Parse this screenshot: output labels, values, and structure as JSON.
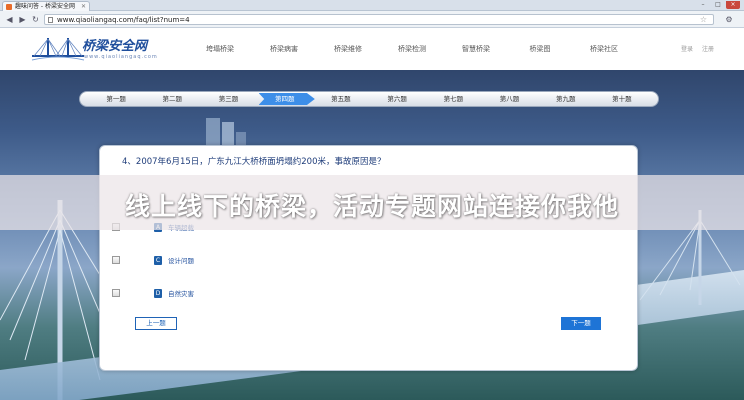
{
  "browser": {
    "tab_title": "趣味问答 - 桥梁安全网",
    "url": "www.qiaoliangaq.com/faq/list?num=4",
    "window_controls": [
      "–",
      "□",
      "×"
    ]
  },
  "site": {
    "logo_text": "桥梁安全网",
    "logo_url": "www.qiaoliangaq.com",
    "nav": [
      "垮塌桥梁",
      "桥梁病害",
      "桥梁维修",
      "桥梁检测",
      "智慧桥梁",
      "桥梁图",
      "桥梁社区"
    ],
    "toplinks": [
      "登录",
      "注册"
    ]
  },
  "steps": {
    "items": [
      "第一题",
      "第二题",
      "第三题",
      "第四题",
      "第五题",
      "第六题",
      "第七题",
      "第八题",
      "第九题",
      "第十题"
    ],
    "active_index": 3
  },
  "quiz": {
    "question": "4、2007年6月15日，广东九江大桥桥面坍塌约200米，事故原因是？",
    "options": [
      {
        "label": "车辆超载",
        "icon": "A"
      },
      {
        "label": "设计问题",
        "icon": "C"
      },
      {
        "label": "自然灾害",
        "icon": "D"
      }
    ],
    "prev_label": "上一题",
    "next_label": "下一题"
  },
  "banner": {
    "text": "线上线下的桥梁，活动专题网站连接你我他"
  },
  "colors": {
    "accent": "#1e74d6",
    "brand": "#1f4e9c"
  }
}
